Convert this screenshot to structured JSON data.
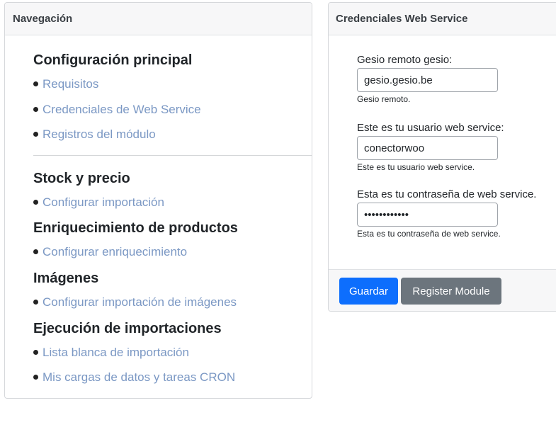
{
  "navigation": {
    "header": "Navegación",
    "sections": [
      {
        "title": "Configuración principal",
        "items": [
          "Requisitos",
          "Credenciales de Web Service",
          "Registros del módulo"
        ]
      },
      {
        "title": "Stock y precio",
        "items": [
          "Configurar importación"
        ]
      },
      {
        "title": "Enriquecimiento de productos",
        "items": [
          "Configurar enriquecimiento"
        ]
      },
      {
        "title": "Imágenes",
        "items": [
          "Configurar importación de imágenes"
        ]
      },
      {
        "title": "Ejecución de importaciones",
        "items": [
          "Lista blanca de importación",
          "Mis cargas de datos y tareas CRON"
        ]
      }
    ]
  },
  "credentials": {
    "header": "Credenciales Web Service",
    "fields": [
      {
        "label": "Gesio remoto gesio:",
        "value": "gesio.gesio.be",
        "help": "Gesio remoto."
      },
      {
        "label": "Este es tu usuario web service:",
        "value": "conectorwoo",
        "help": "Este es tu usuario web service."
      },
      {
        "label": "Esta es tu contraseña de web service.",
        "value": "••••••••••••",
        "help": "Esta es tu contraseña de web service."
      }
    ],
    "save_label": "Guardar",
    "register_label": "Register Module"
  }
}
